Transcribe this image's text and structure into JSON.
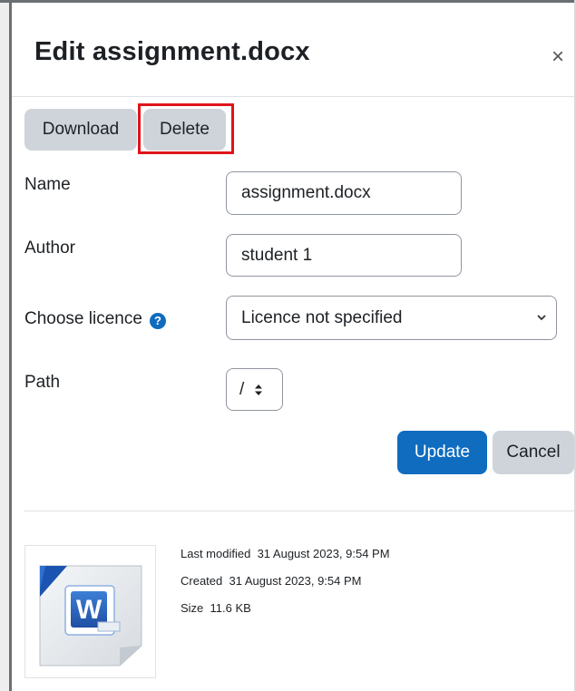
{
  "dialog": {
    "title": "Edit assignment.docx",
    "close_symbol": "×"
  },
  "actions": {
    "download_label": "Download",
    "delete_label": "Delete"
  },
  "form": {
    "name_label": "Name",
    "name_value": "assignment.docx",
    "author_label": "Author",
    "author_value": "student 1",
    "licence_label": "Choose licence",
    "licence_value": "Licence not specified",
    "path_label": "Path",
    "path_value": "/"
  },
  "footer_buttons": {
    "update_label": "Update",
    "cancel_label": "Cancel"
  },
  "file_info": {
    "last_modified_label": "Last modified",
    "last_modified_value": "31 August 2023, 9:54 PM",
    "created_label": "Created",
    "created_value": "31 August 2023, 9:54 PM",
    "size_label": "Size",
    "size_value": "11.6 KB"
  },
  "icons": {
    "help": "help-icon",
    "file": "word-document-icon"
  },
  "colors": {
    "primary": "#0f6cbf",
    "secondary": "#ced4da",
    "highlight": "#e0141b"
  }
}
